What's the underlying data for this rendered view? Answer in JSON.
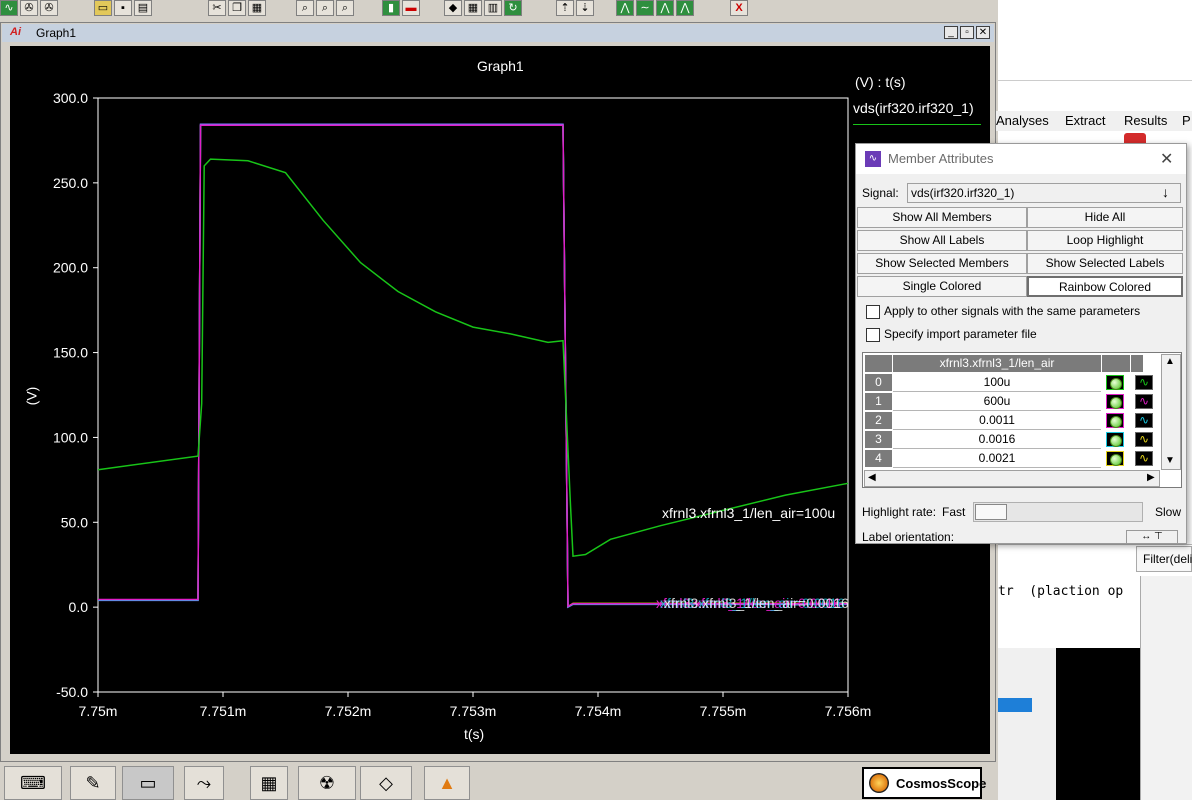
{
  "graph_window": {
    "title": "Graph1",
    "logo": "Ai"
  },
  "plot": {
    "title": "Graph1",
    "ylabel": "(V)",
    "xlabel": "t(s)",
    "legend_header": "(V) : t(s)",
    "legend_signal": "vds(irf320.irf320_1)",
    "y_ticks": [
      "300.0",
      "250.0",
      "200.0",
      "150.0",
      "100.0",
      "50.0",
      "0.0",
      "-50.0"
    ],
    "x_ticks": [
      "7.75m",
      "7.751m",
      "7.752m",
      "7.753m",
      "7.754m",
      "7.755m",
      "7.756m"
    ],
    "trace_label_green": "xfrnl3.xfrnl3_1/len_air=100u",
    "trace_label_overlap": "xfrnl3.xfrnl3_1/len_air=0.0016"
  },
  "chart_data": {
    "type": "line",
    "title": "Graph1",
    "xlabel": "t(s)",
    "ylabel": "(V)",
    "xlim": [
      7.75,
      7.756
    ],
    "ylim": [
      -50,
      300
    ],
    "grid": false,
    "legend": "top-right",
    "series": [
      {
        "name": "xfrnl3.xfrnl3_1/len_air=100u",
        "color": "#18c418",
        "x": [
          7.75,
          7.7508,
          7.75083,
          7.75085,
          7.7509,
          7.7512,
          7.7515,
          7.7518,
          7.7521,
          7.7524,
          7.7527,
          7.753,
          7.7533,
          7.7536,
          7.75372,
          7.75378,
          7.7538,
          7.7539,
          7.7541,
          7.7545,
          7.755,
          7.7555,
          7.756
        ],
        "y": [
          81,
          89,
          120,
          260,
          264,
          263,
          256,
          228,
          203,
          186,
          174,
          165,
          161,
          156,
          157,
          60,
          30,
          31,
          40,
          48,
          57,
          66,
          73
        ]
      },
      {
        "name": "xfrnl3.xfrnl3_1/len_air=600u",
        "color": "#e01ec8",
        "x": [
          7.75,
          7.7508,
          7.75082,
          7.7537,
          7.75372,
          7.75376,
          7.7538,
          7.756
        ],
        "y": [
          4.5,
          4.5,
          284,
          284,
          284,
          0.5,
          2,
          2
        ]
      },
      {
        "name": "xfrnl3.xfrnl3_1/len_air=0.0011",
        "color": "#19c8e0",
        "x": [
          7.75,
          7.7508,
          7.75082,
          7.7537,
          7.75372,
          7.75376,
          7.7538,
          7.756
        ],
        "y": [
          4.2,
          4.2,
          284,
          284,
          284,
          0.3,
          1.8,
          1.8
        ]
      },
      {
        "name": "xfrnl3.xfrnl3_1/len_air=0.0016",
        "color": "#7a7aff",
        "x": [
          7.75,
          7.7508,
          7.75082,
          7.7537,
          7.75372,
          7.75376,
          7.7538,
          7.756
        ],
        "y": [
          4,
          4,
          284.5,
          284.5,
          284.5,
          0,
          1.6,
          1.6
        ]
      },
      {
        "name": "xfrnl3.xfrnl3_1/len_air=0.0021",
        "color": "#e2d21a",
        "x": [
          7.75,
          7.7508,
          7.75082,
          7.7537,
          7.75372,
          7.75376,
          7.7538,
          7.756
        ],
        "y": [
          4.4,
          4.4,
          284,
          284,
          284,
          0.4,
          2.2,
          2.2
        ]
      }
    ]
  },
  "member_attributes": {
    "title": "Member Attributes",
    "signal_label": "Signal:",
    "signal_value": "vds(irf320.irf320_1)",
    "buttons": {
      "show_all_members": "Show All Members",
      "hide_all": "Hide All",
      "show_all_labels": "Show All Labels",
      "loop_highlight": "Loop Highlight",
      "show_selected_members": "Show Selected Members",
      "show_selected_labels": "Show Selected Labels",
      "single_colored": "Single Colored",
      "rainbow_colored": "Rainbow Colored"
    },
    "checks": {
      "apply_other": "Apply to other signals with the same parameters",
      "specify_import": "Specify import parameter file"
    },
    "table": {
      "header": "xfrnl3.xfrnl3_1/len_air",
      "rows": [
        {
          "index": "0",
          "value": "100u",
          "color": "#18c418"
        },
        {
          "index": "1",
          "value": "600u",
          "color": "#e01ec8"
        },
        {
          "index": "2",
          "value": "0.0011",
          "color": "#19c8e0"
        },
        {
          "index": "3",
          "value": "0.0016",
          "color": "#e2d21a"
        },
        {
          "index": "4",
          "value": "0.0021",
          "color": "#e2d21a"
        }
      ]
    },
    "highlight_rate": "Highlight rate:",
    "fast": "Fast",
    "slow": "Slow",
    "label_orientation": "Label orientation:"
  },
  "background_app": {
    "menu": [
      "Analyses",
      "Extract",
      "Results",
      "P"
    ],
    "text_snippet": "tr  (plaction op",
    "filter_tab": "Filter(delin"
  },
  "taskbar": {
    "cosmos_label": "CosmosScope"
  }
}
